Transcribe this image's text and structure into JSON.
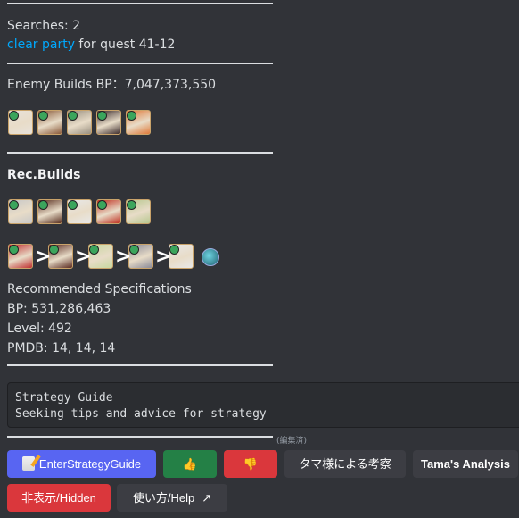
{
  "searches": "Searches: 2",
  "clear_party_link": "clear party",
  "quest_text": " for quest 41-12",
  "enemy_builds_bp": "Enemy Builds BP：7,047,373,550",
  "rec_builds_title": "Rec.Builds",
  "rec_spec_title": "Recommended Specifications",
  "bp": "BP: 531,286,463",
  "level": "Level: 492",
  "pmdb": "PMDB: 14, 14, 14",
  "code_block": {
    "line1": "Strategy Guide",
    "line2": "Seeking tips and advice for strategy"
  },
  "edited_label": "(編集済)",
  "buttons": {
    "enter_strategy_guide": "EnterStrategyGuide",
    "thumbs_up": "👍",
    "thumbs_down": "👎",
    "tama_consideration": "タマ様による考察",
    "tama_analysis": "Tama's Analysis",
    "hidden": "非表示/Hidden",
    "how_to_use": "使い方/Help",
    "external_link_icon": "↗"
  },
  "colors": {
    "background": "#313338",
    "link": "#00a8fc",
    "blurple": "#5865f2",
    "green": "#248046",
    "red": "#da373c",
    "grey": "#3c3d43"
  },
  "avatars": {
    "enemy_builds": [
      "#e8e2da",
      "#8a5a3a",
      "#9a9080",
      "#3a2a2a",
      "#e07a3a"
    ],
    "rec_builds": [
      "#c8c8c8",
      "#5a3020",
      "#e8e8e8",
      "#c03020",
      "#b8c890"
    ],
    "rotation": [
      "#c03030",
      "#5a2a20",
      "#c8d8a0",
      "#8a8a98",
      "#e8e8e8"
    ]
  }
}
